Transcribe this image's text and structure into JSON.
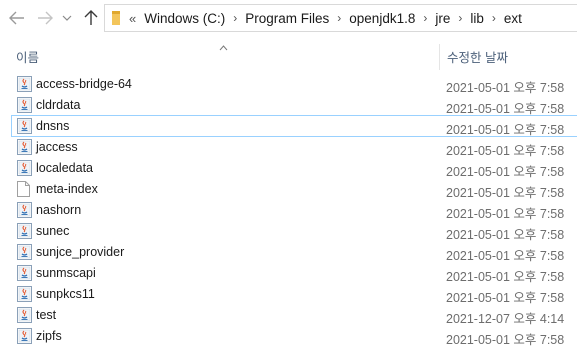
{
  "breadcrumb": {
    "overflow": "«",
    "items": [
      "Windows (C:)",
      "Program Files",
      "openjdk1.8",
      "jre",
      "lib",
      "ext"
    ]
  },
  "columns": {
    "name": "이름",
    "date_modified": "수정한 날짜"
  },
  "files": [
    {
      "name": "access-bridge-64",
      "date": "2021-05-01 오후 7:58",
      "icon": "java-jar-icon"
    },
    {
      "name": "cldrdata",
      "date": "2021-05-01 오후 7:58",
      "icon": "java-jar-icon"
    },
    {
      "name": "dnsns",
      "date": "2021-05-01 오후 7:58",
      "icon": "java-jar-icon",
      "focused": true
    },
    {
      "name": "jaccess",
      "date": "2021-05-01 오후 7:58",
      "icon": "java-jar-icon"
    },
    {
      "name": "localedata",
      "date": "2021-05-01 오후 7:58",
      "icon": "java-jar-icon"
    },
    {
      "name": "meta-index",
      "date": "2021-05-01 오후 7:58",
      "icon": "blank-file-icon"
    },
    {
      "name": "nashorn",
      "date": "2021-05-01 오후 7:58",
      "icon": "java-jar-icon"
    },
    {
      "name": "sunec",
      "date": "2021-05-01 오후 7:58",
      "icon": "java-jar-icon"
    },
    {
      "name": "sunjce_provider",
      "date": "2021-05-01 오후 7:58",
      "icon": "java-jar-icon"
    },
    {
      "name": "sunmscapi",
      "date": "2021-05-01 오후 7:58",
      "icon": "java-jar-icon"
    },
    {
      "name": "sunpkcs11",
      "date": "2021-05-01 오후 7:58",
      "icon": "java-jar-icon"
    },
    {
      "name": "test",
      "date": "2021-12-07 오후 4:14",
      "icon": "java-jar-icon"
    },
    {
      "name": "zipfs",
      "date": "2021-05-01 오후 7:58",
      "icon": "java-jar-icon"
    }
  ],
  "colors": {
    "header_text": "#4c607a",
    "focus_outline": "#99d1ff",
    "date_text": "#6d6d6d"
  }
}
